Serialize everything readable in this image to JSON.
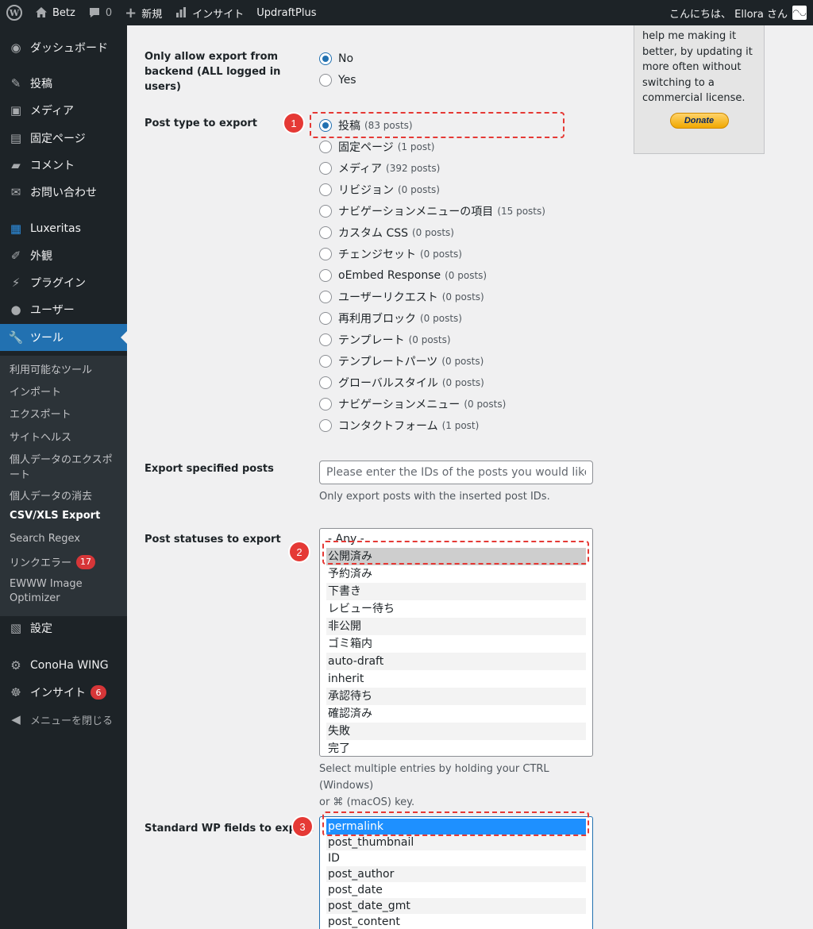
{
  "adminbar": {
    "site_name": "Betz",
    "comments_count": "0",
    "new_label": "新規",
    "insight_label": "インサイト",
    "updraft_label": "UpdraftPlus",
    "greeting": "こんにちは、 Ellora さん"
  },
  "sidebar": {
    "items": [
      {
        "label": "ダッシュボード",
        "icon": "gauge-icon"
      },
      {
        "label": "投稿",
        "icon": "pin-icon"
      },
      {
        "label": "メディア",
        "icon": "media-icon"
      },
      {
        "label": "固定ページ",
        "icon": "page-icon"
      },
      {
        "label": "コメント",
        "icon": "comment-icon"
      },
      {
        "label": "お問い合わせ",
        "icon": "mail-icon"
      },
      {
        "label": "Luxeritas",
        "icon": "grid-icon"
      },
      {
        "label": "外観",
        "icon": "brush-icon"
      },
      {
        "label": "プラグイン",
        "icon": "plug-icon"
      },
      {
        "label": "ユーザー",
        "icon": "user-icon"
      },
      {
        "label": "ツール",
        "icon": "wrench-icon"
      }
    ],
    "submenu": [
      "利用可能なツール",
      "インポート",
      "エクスポート",
      "サイトヘルス",
      "個人データのエクスポ",
      "ート",
      "個人データの消去",
      "CSV/XLS Export",
      "Search Regex",
      "リンクエラー",
      "EWWW Image",
      "Optimizer"
    ],
    "link_errors_badge": "17",
    "bottom_items": [
      {
        "label": "設定",
        "icon": "settings-icon"
      },
      {
        "label": "ConoHa WING",
        "icon": "gear-icon"
      },
      {
        "label": "インサイト",
        "icon": "insight-icon"
      }
    ],
    "insight_badge": "6",
    "collapse_label": "メニューを閉じる"
  },
  "sidebox": {
    "lines": [
      "help me making it",
      "better, by updating it",
      "more often without",
      "switching to a",
      "commercial license."
    ],
    "donate_label": "Donate"
  },
  "form": {
    "backend_only": {
      "label_line1": "Only allow export from",
      "label_line2": "backend (ALL logged in users)",
      "options": [
        "No",
        "Yes"
      ]
    },
    "post_type": {
      "label": "Post type to export",
      "options": [
        {
          "name": "投稿",
          "count": "(83 posts)"
        },
        {
          "name": "固定ページ",
          "count": "(1 post)"
        },
        {
          "name": "メディア",
          "count": "(392 posts)"
        },
        {
          "name": "リビジョン",
          "count": "(0 posts)"
        },
        {
          "name": "ナビゲーションメニューの項目",
          "count": "(15 posts)"
        },
        {
          "name": "カスタム CSS",
          "count": "(0 posts)"
        },
        {
          "name": "チェンジセット",
          "count": "(0 posts)"
        },
        {
          "name": "oEmbed Response",
          "count": "(0 posts)"
        },
        {
          "name": "ユーザーリクエスト",
          "count": "(0 posts)"
        },
        {
          "name": "再利用ブロック",
          "count": "(0 posts)"
        },
        {
          "name": "テンプレート",
          "count": "(0 posts)"
        },
        {
          "name": "テンプレートパーツ",
          "count": "(0 posts)"
        },
        {
          "name": "グローバルスタイル",
          "count": "(0 posts)"
        },
        {
          "name": "ナビゲーションメニュー",
          "count": "(0 posts)"
        },
        {
          "name": "コンタクトフォーム",
          "count": "(1 post)"
        }
      ]
    },
    "specified_posts": {
      "label": "Export specified posts",
      "placeholder": "Please enter the IDs of the posts you would like to ex",
      "description": "Only export posts with the inserted post IDs."
    },
    "statuses": {
      "label": "Post statuses to export",
      "options": [
        "- Any -",
        "公開済み",
        "予約済み",
        "下書き",
        "レビュー待ち",
        "非公開",
        "ゴミ箱内",
        "auto-draft",
        "inherit",
        "承認待ち",
        "確認済み",
        "失敗",
        "完了"
      ],
      "desc_line1": "Select multiple entries by holding your CTRL (Windows)",
      "desc_line2": "or ⌘ (macOS) key."
    },
    "wp_fields": {
      "label": "Standard WP fields to export",
      "options": [
        "permalink",
        "post_thumbnail",
        "ID",
        "post_author",
        "post_date",
        "post_date_gmt",
        "post_content"
      ]
    }
  },
  "callouts": [
    "1",
    "2",
    "3"
  ],
  "colors": {
    "accent": "#2271b1",
    "callout": "#e53935",
    "sidebar_bg": "#1d2327"
  }
}
